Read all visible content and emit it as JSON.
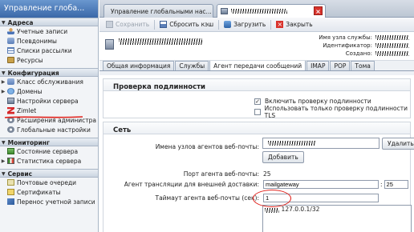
{
  "app": {
    "title": "Управление глоба..."
  },
  "sidebar": {
    "sections": [
      {
        "label": "Адреса",
        "items": [
          "Учетные записи",
          "Псевдонимы",
          "Списки рассылки",
          "Ресурсы"
        ]
      },
      {
        "label": "Конфигурация",
        "items": [
          "Класс обслуживания",
          "Домены",
          "Настройки сервера",
          "Zimlet",
          "Расширения администра",
          "Глобальные настройки"
        ]
      },
      {
        "label": "Мониторинг",
        "items": [
          "Состояние сервера",
          "Статистика сервера"
        ]
      },
      {
        "label": "Сервис",
        "items": [
          "Почтовые очереди",
          "Сертификаты",
          "Перенос учетной записи"
        ]
      }
    ]
  },
  "tabs": [
    {
      "label": "Управление глобальными нас..."
    },
    {
      "label": ""
    }
  ],
  "toolbar": {
    "save": "Сохранить",
    "flush_cache": "Сбросить кэш",
    "load": "Загрузить",
    "close": "Закрыть"
  },
  "server": {
    "name": "",
    "meta": [
      {
        "label": "Имя узла службы:",
        "value": ""
      },
      {
        "label": "Идентификатор:",
        "value": ""
      },
      {
        "label": "Создано:",
        "value": ""
      }
    ]
  },
  "subtabs": [
    "Общая информация",
    "Службы",
    "Агент передачи сообщений",
    "IMAP",
    "POP",
    "Тома"
  ],
  "auth_section": {
    "title": "Проверка подлинности",
    "enable_auth": "Включить проверку подлинности",
    "tls_only": "Использовать только проверку подлинности TLS"
  },
  "network_section": {
    "title": "Сеть",
    "web_agent_hosts_label": "Имена узлов агентов веб-почты:",
    "delete_button": "Удалить",
    "add_button": "Добавить",
    "web_agent_port_label": "Порт агента веб-почты:",
    "web_agent_port": "25",
    "relay_label": "Агент трансляции для внешней доставки:",
    "relay_host": "mailgateway",
    "relay_port": "25",
    "timeout_label": "Таймаут агента веб-почты (сек):",
    "timeout_value": "1",
    "network_entry": "127.0.0.1/32"
  },
  "colors": {
    "title_bar": "#3a68a8",
    "annotation": "#e0201a",
    "close_red": "#d9332c"
  }
}
